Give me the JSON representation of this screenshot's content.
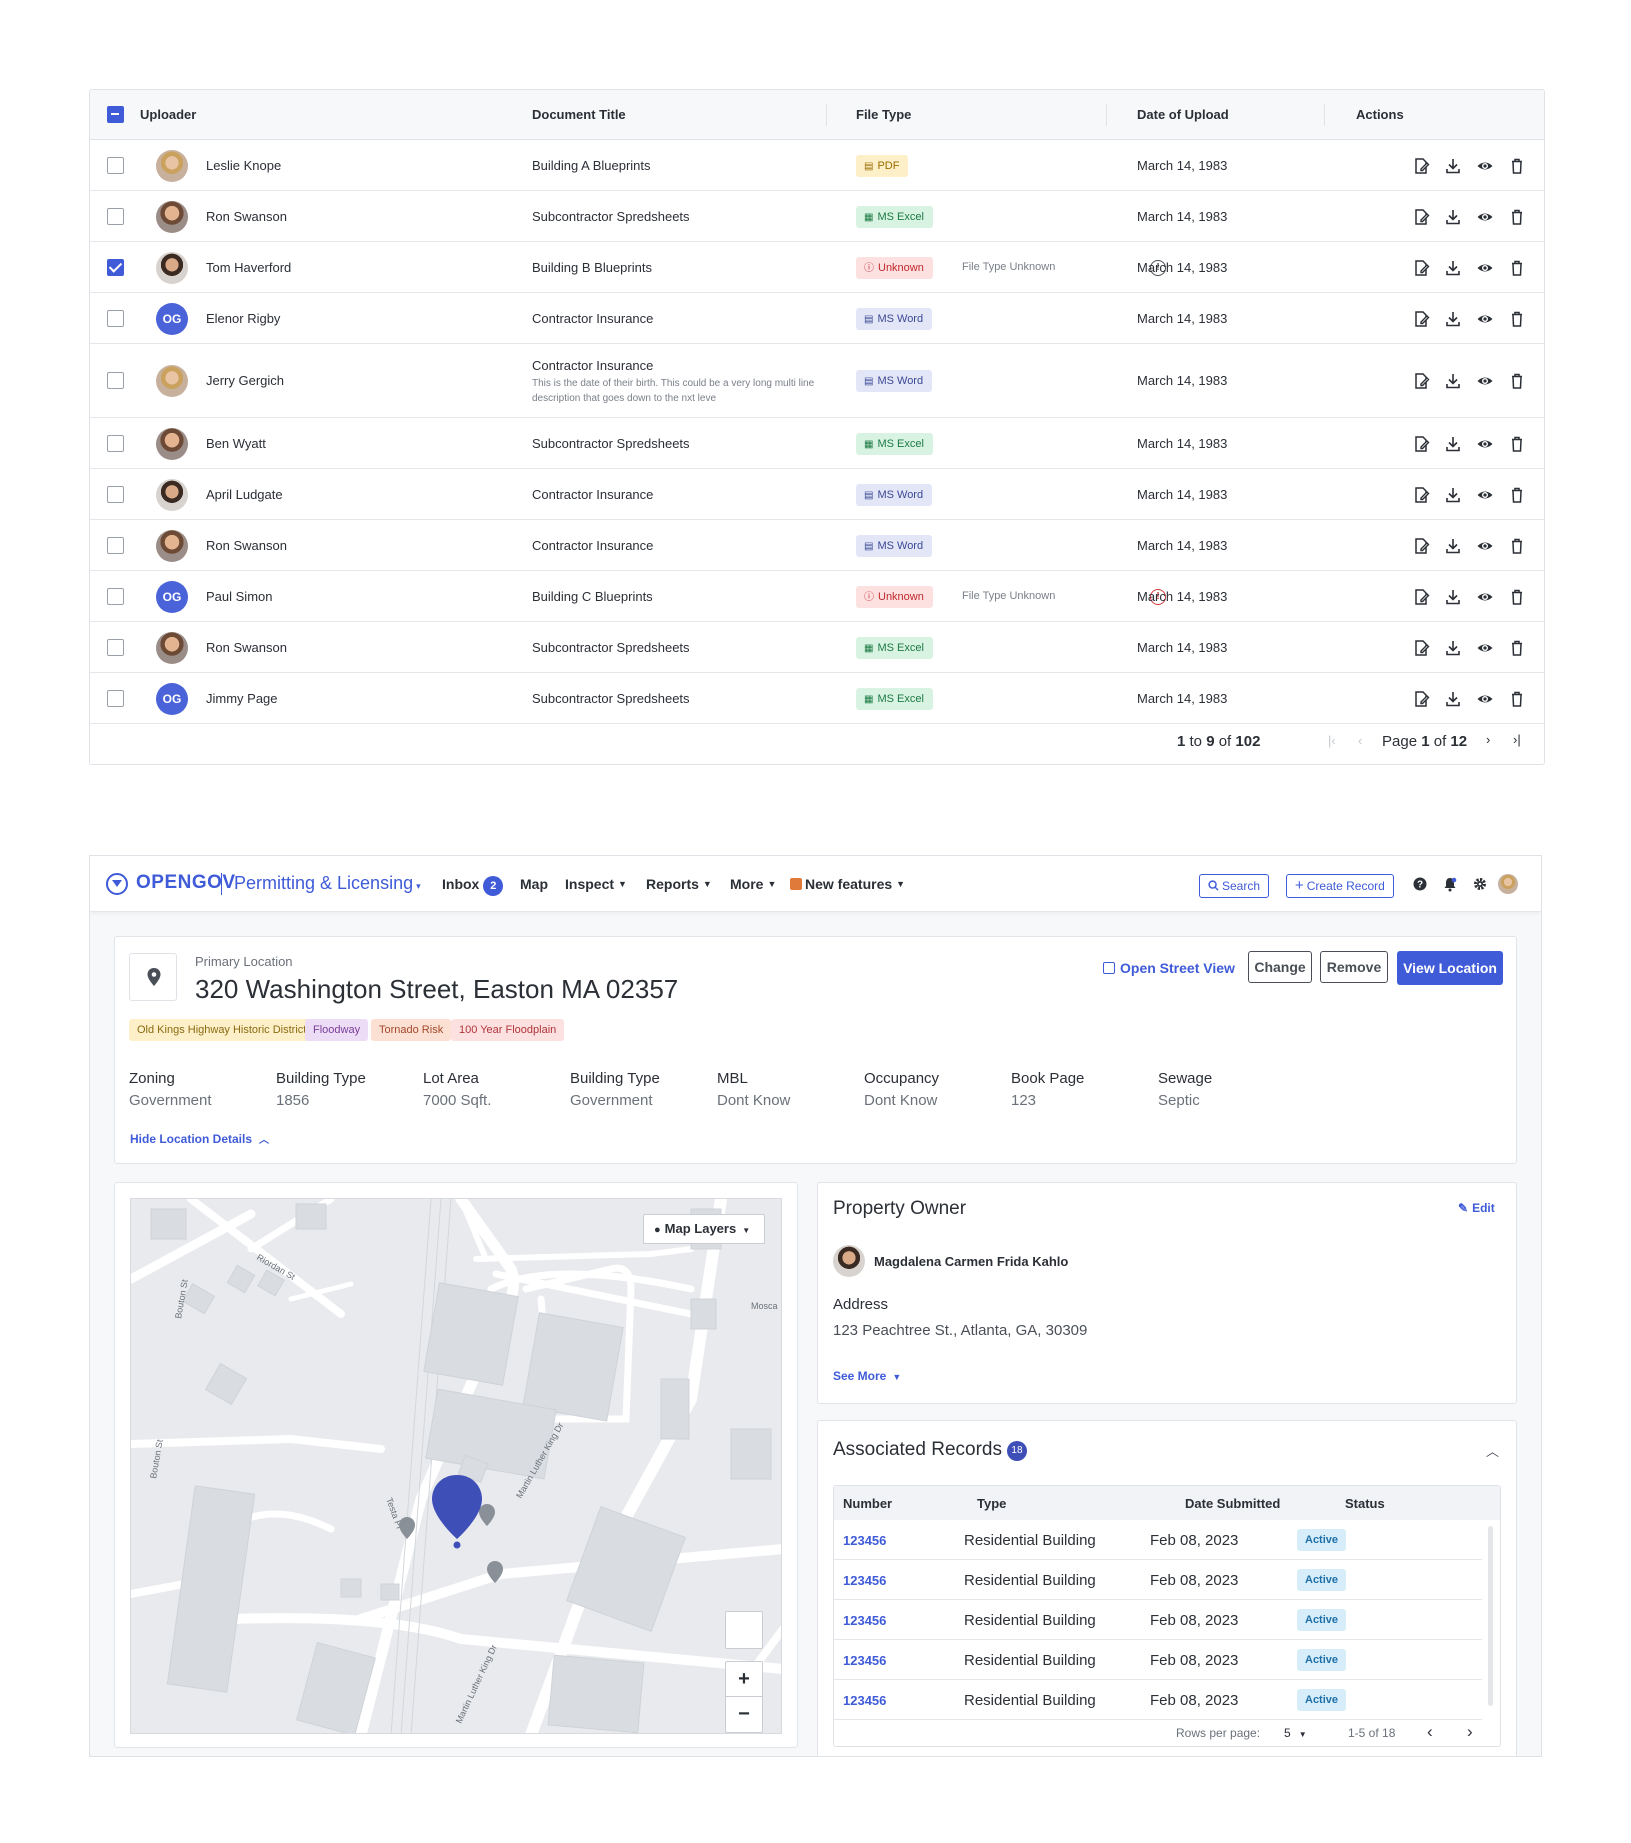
{
  "documents": {
    "headers": {
      "uploader": "Uploader",
      "title": "Document Title",
      "file_type": "File Type",
      "date": "Date of Upload",
      "actions": "Actions"
    },
    "rows": [
      {
        "name": "Leslie Knope",
        "title": "Building A Blueprints",
        "type": "PDF",
        "date": "March 14, 1983",
        "checked": false
      },
      {
        "name": "Ron Swanson",
        "title": "Subcontractor Spredsheets",
        "type": "MS Excel",
        "date": "March 14, 1983",
        "checked": false
      },
      {
        "name": "Tom Haverford",
        "title": "Building B Blueprints",
        "type": "Unknown",
        "note": "File Type Unknown",
        "date": "March 14, 1983",
        "checked": true
      },
      {
        "name": "Elenor Rigby",
        "initials": "OG",
        "title": "Contractor Insurance",
        "type": "MS Word",
        "date": "March 14, 1983",
        "checked": false
      },
      {
        "name": "Jerry Gergich",
        "title": "Contractor Insurance",
        "description": "This is the date of their birth. This could be a very long multi line description that goes down to the nxt leve",
        "type": "MS Word",
        "date": "March 14, 1983",
        "checked": false
      },
      {
        "name": "Ben Wyatt",
        "title": "Subcontractor Spredsheets",
        "type": "MS Excel",
        "date": "March 14, 1983",
        "checked": false
      },
      {
        "name": "April Ludgate",
        "title": "Contractor Insurance",
        "type": "MS Word",
        "date": "March 14, 1983",
        "checked": false
      },
      {
        "name": "Ron Swanson",
        "title": "Contractor Insurance",
        "type": "MS Word",
        "date": "March 14, 1983",
        "checked": false
      },
      {
        "name": "Paul Simon",
        "initials": "OG",
        "title": "Building C Blueprints",
        "type": "Unknown",
        "note": "File Type Unknown",
        "date": "March 14, 1983",
        "checked": false
      },
      {
        "name": "Ron Swanson",
        "title": "Subcontractor Spredsheets",
        "type": "MS Excel",
        "date": "March 14, 1983",
        "checked": false
      },
      {
        "name": "Jimmy Page",
        "initials": "OG",
        "title": "Subcontractor Spredsheets",
        "type": "MS Excel",
        "date": "March 14, 1983",
        "checked": false
      }
    ],
    "footer": {
      "from": "1",
      "to_word": "to",
      "to": "9",
      "of_word": "of",
      "total": "102",
      "page_word": "Page",
      "page": "1",
      "page_of": "of",
      "pages": "12"
    }
  },
  "app": {
    "logo": "OPENGOV",
    "product": "Permitting & Licensing",
    "nav": {
      "inbox": "Inbox",
      "inbox_count": "2",
      "map": "Map",
      "inspect": "Inspect",
      "reports": "Reports",
      "more": "More",
      "new_features": "New features"
    },
    "search": "Search",
    "create_record": "Create Record"
  },
  "location": {
    "label": "Primary Location",
    "address": "320 Washington Street, Easton MA 02357",
    "open_street_view": "Open Street View",
    "change": "Change",
    "remove": "Remove",
    "view_location": "View Location",
    "tags": [
      {
        "label": "Old Kings Highway Historic District",
        "bg": "#fdf0c9",
        "fg": "#8a6a10"
      },
      {
        "label": "Floodway",
        "bg": "#ecdcf5",
        "fg": "#7a3d9a"
      },
      {
        "label": "Tornado Risk",
        "bg": "#fbe0d3",
        "fg": "#a4482a"
      },
      {
        "label": "100 Year Floodplain",
        "bg": "#fde0e0",
        "fg": "#b0353a"
      }
    ],
    "fields": [
      {
        "label": "Zoning",
        "value": "Government"
      },
      {
        "label": "Building Type",
        "value": "1856"
      },
      {
        "label": "Lot Area",
        "value": "7000 Sqft."
      },
      {
        "label": "Building Type",
        "value": "Government"
      },
      {
        "label": "MBL",
        "value": "Dont Know"
      },
      {
        "label": "Occupancy",
        "value": "Dont Know"
      },
      {
        "label": "Book Page",
        "value": "123"
      },
      {
        "label": "Sewage",
        "value": "Septic"
      }
    ],
    "hide_details": "Hide Location Details"
  },
  "map": {
    "layers_button": "Map Layers",
    "streets": [
      "Riordan St",
      "Bouton St",
      "Bouton St",
      "Testa Pl",
      "Martin Luther King Dr",
      "Martin Luther King Dr",
      "Mosca"
    ]
  },
  "owner": {
    "heading": "Property Owner",
    "edit": "Edit",
    "name": "Magdalena Carmen Frida Kahlo",
    "address_label": "Address",
    "address": "123 Peachtree St., Atlanta, GA, 30309",
    "see_more": "See More"
  },
  "records": {
    "heading": "Associated Records",
    "count": "18",
    "columns": {
      "number": "Number",
      "type": "Type",
      "date": "Date Submitted",
      "status": "Status"
    },
    "rows": [
      {
        "number": "123456",
        "type": "Residential Building",
        "date": "Feb 08, 2023",
        "status": "Active"
      },
      {
        "number": "123456",
        "type": "Residential Building",
        "date": "Feb 08, 2023",
        "status": "Active"
      },
      {
        "number": "123456",
        "type": "Residential Building",
        "date": "Feb 08, 2023",
        "status": "Active"
      },
      {
        "number": "123456",
        "type": "Residential Building",
        "date": "Feb 08, 2023",
        "status": "Active"
      },
      {
        "number": "123456",
        "type": "Residential Building",
        "date": "Feb 08, 2023",
        "status": "Active"
      }
    ],
    "rows_per_page_label": "Rows per page:",
    "rows_per_page": "5",
    "range": "1-5 of 18"
  }
}
